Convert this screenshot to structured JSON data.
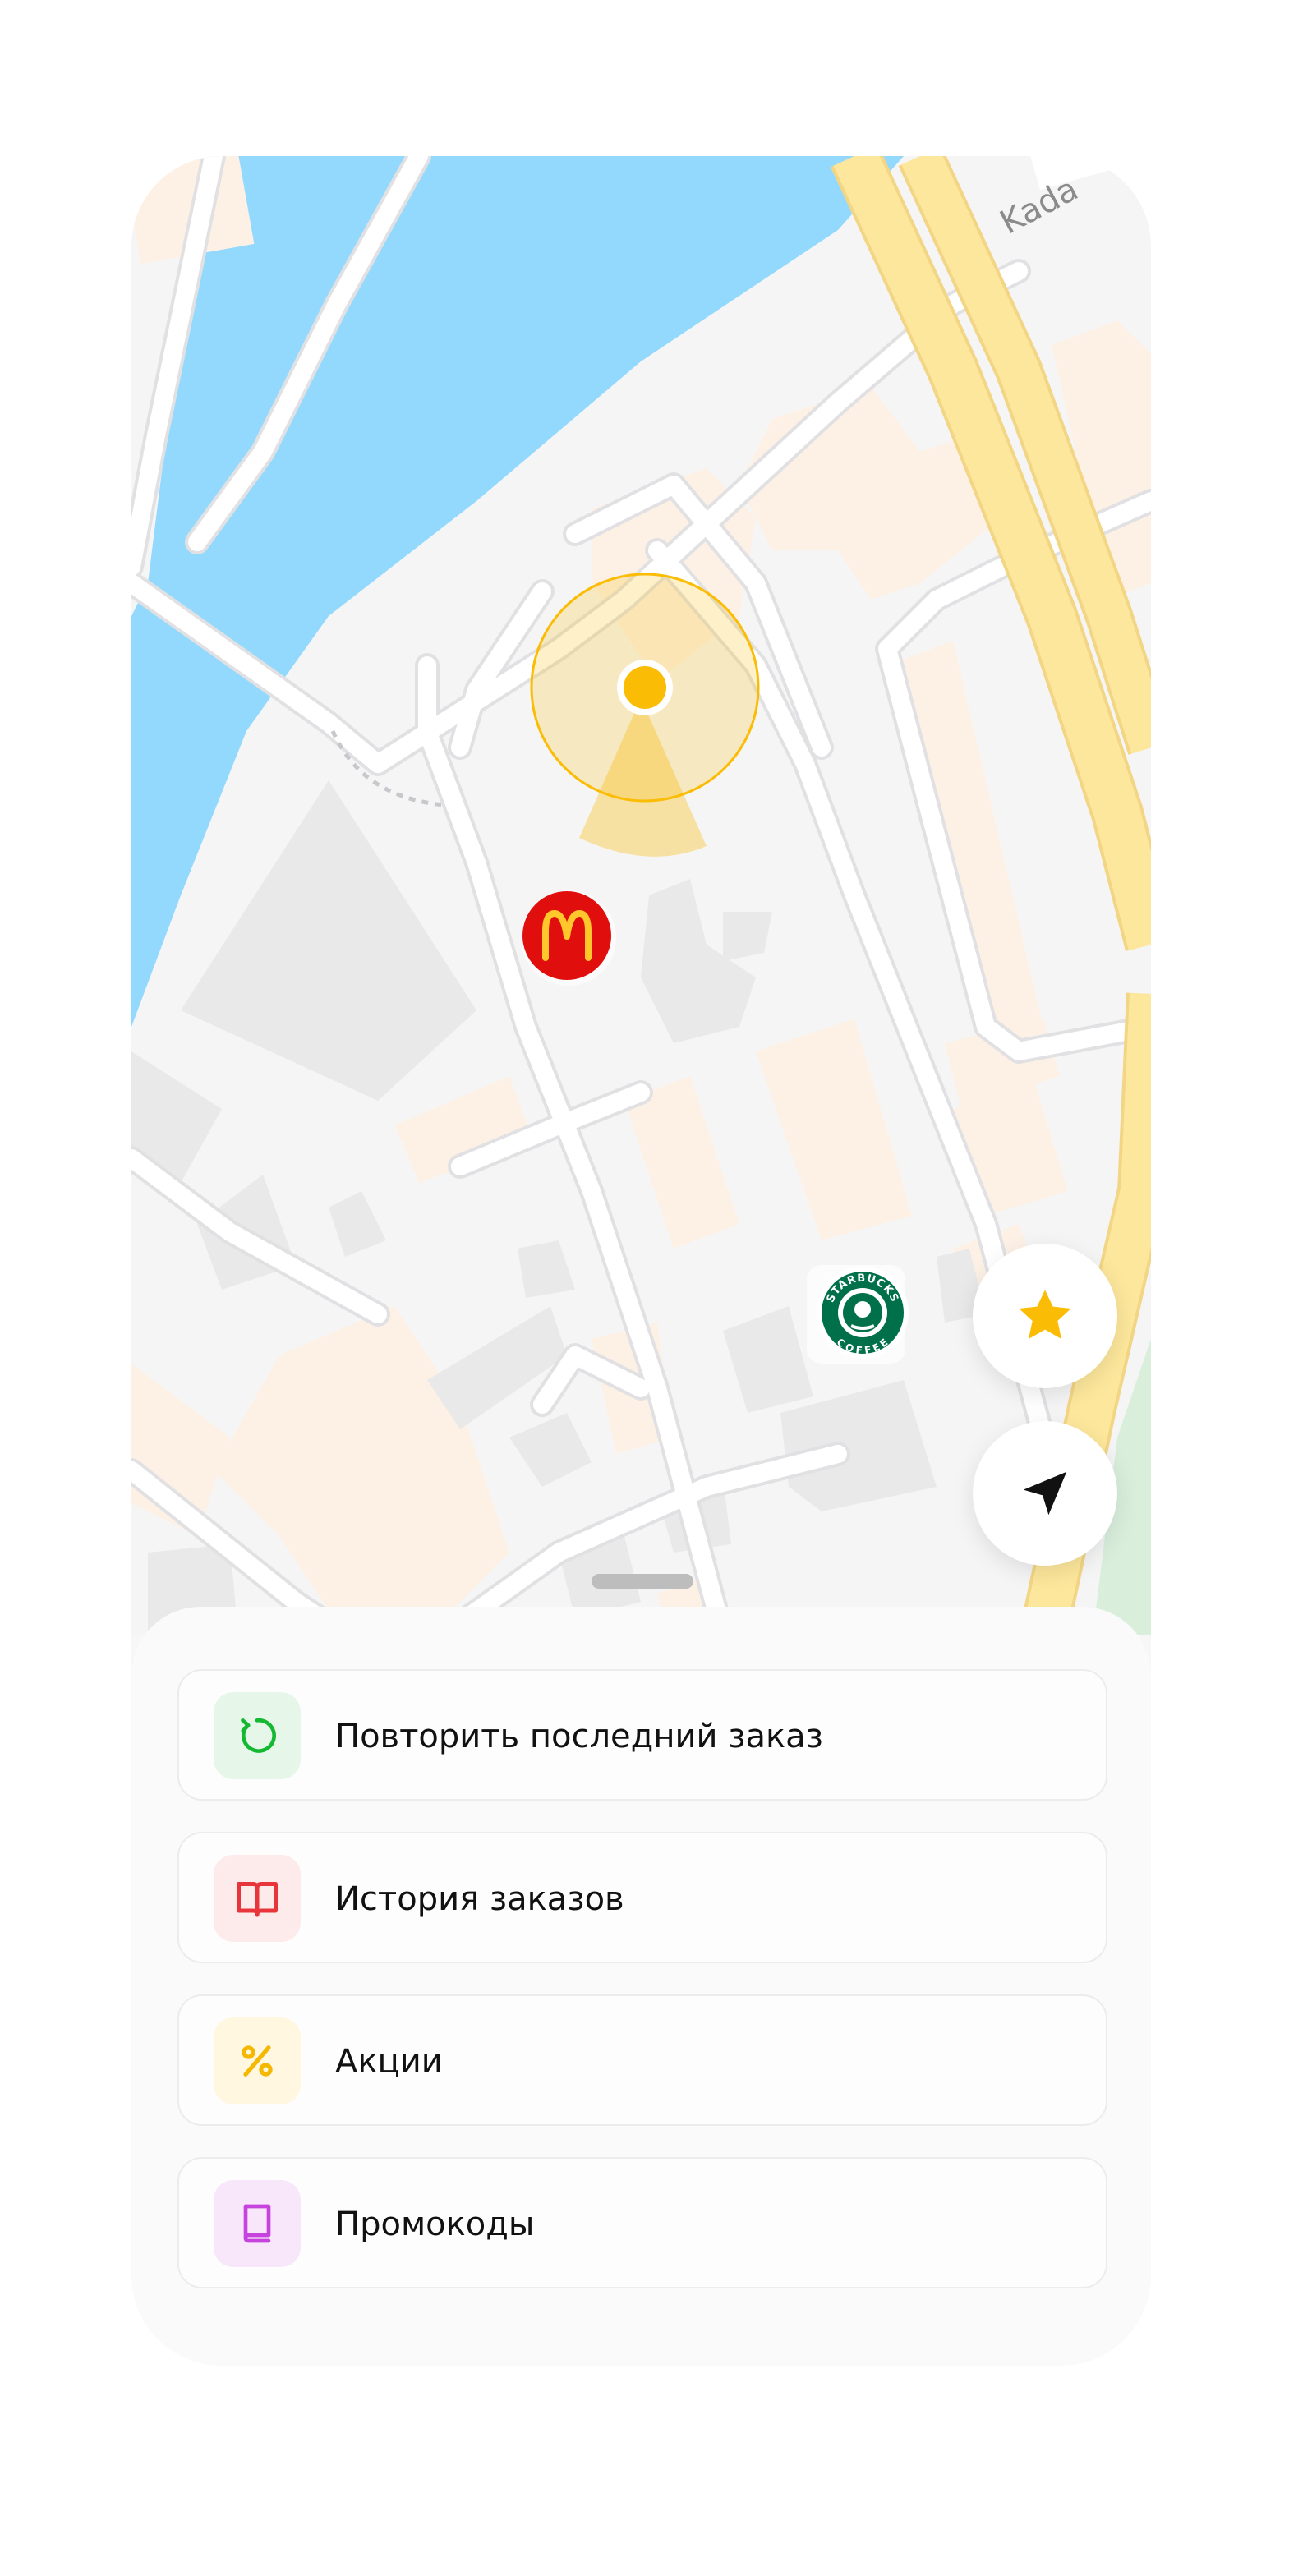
{
  "map": {
    "street_label": "Kada",
    "pins": {
      "mcdonalds": {
        "name": "McDonald's",
        "glyph": "M",
        "color": "#e10e0e",
        "glyph_color": "#ffc72c"
      },
      "starbucks": {
        "top_text": "STARBUCKS",
        "bottom_text": "COFFEE",
        "color": "#00704a"
      }
    },
    "user_location_color": "#fbbc05"
  },
  "controls": {
    "favorites_icon": "star-icon",
    "locate_icon": "navigation-arrow-icon"
  },
  "menu": [
    {
      "label": "Повторить последний заказ",
      "icon": "repeat-icon",
      "icon_bg": "#e6f7ea",
      "icon_color": "#14b831"
    },
    {
      "label": "История заказов",
      "icon": "book-open-icon",
      "icon_bg": "#fdeaea",
      "icon_color": "#e8353b"
    },
    {
      "label": "Акции",
      "icon": "percent-icon",
      "icon_bg": "#fff7e0",
      "icon_color": "#f5b800"
    },
    {
      "label": "Промокоды",
      "icon": "book-icon",
      "icon_bg": "#f8e7fb",
      "icon_color": "#c643de"
    }
  ]
}
